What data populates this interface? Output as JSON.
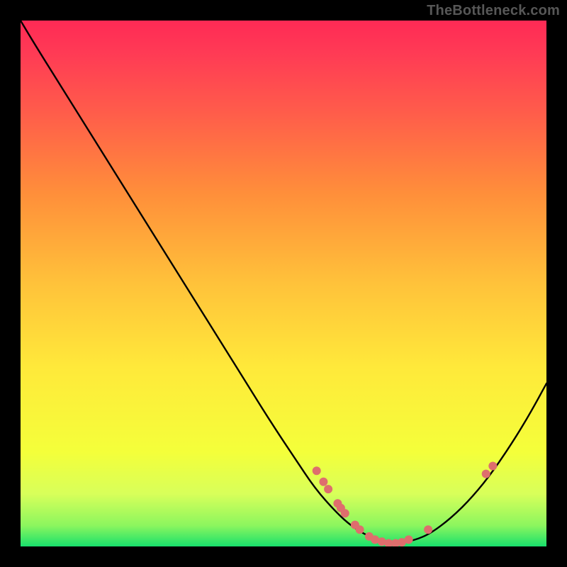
{
  "watermark": "TheBottleneck.com",
  "chart_data": {
    "type": "line",
    "title": "",
    "xlabel": "",
    "ylabel": "",
    "xlim": [
      0,
      100
    ],
    "ylim": [
      0,
      100
    ],
    "background_gradient": {
      "top": "#ff2a55",
      "mid_upper": "#ff8f3a",
      "mid": "#ffe93a",
      "lower": "#d8ff5a",
      "bottom": "#18e06c",
      "direction": "vertical"
    },
    "curve": {
      "name": "bottleneck-curve",
      "x": [
        0.0,
        3.0,
        8.0,
        13.0,
        18.0,
        23.0,
        28.0,
        33.0,
        38.0,
        43.0,
        48.0,
        52.0,
        56.0,
        60.0,
        63.0,
        66.0,
        69.0,
        72.0,
        75.0,
        78.0,
        82.0,
        86.0,
        90.0,
        94.0,
        97.0,
        100.0
      ],
      "y": [
        100.0,
        95.0,
        87.0,
        79.0,
        71.0,
        63.0,
        55.0,
        47.0,
        39.0,
        31.0,
        23.0,
        17.0,
        11.0,
        6.5,
        3.8,
        2.0,
        1.0,
        0.7,
        1.2,
        2.5,
        5.5,
        9.5,
        14.5,
        20.5,
        25.5,
        31.0
      ]
    },
    "markers": {
      "color": "#de6e6d",
      "radius": 6,
      "points": [
        {
          "x": 56.3,
          "y": 14.4
        },
        {
          "x": 57.6,
          "y": 12.3
        },
        {
          "x": 58.5,
          "y": 10.9
        },
        {
          "x": 60.3,
          "y": 8.2
        },
        {
          "x": 60.9,
          "y": 7.3
        },
        {
          "x": 61.7,
          "y": 6.3
        },
        {
          "x": 63.6,
          "y": 4.1
        },
        {
          "x": 64.5,
          "y": 3.2
        },
        {
          "x": 66.3,
          "y": 1.9
        },
        {
          "x": 67.4,
          "y": 1.3
        },
        {
          "x": 68.7,
          "y": 0.9
        },
        {
          "x": 70.0,
          "y": 0.6
        },
        {
          "x": 71.3,
          "y": 0.6
        },
        {
          "x": 72.5,
          "y": 0.8
        },
        {
          "x": 73.8,
          "y": 1.3
        },
        {
          "x": 77.5,
          "y": 3.2
        },
        {
          "x": 88.5,
          "y": 13.8
        },
        {
          "x": 89.8,
          "y": 15.3
        }
      ]
    }
  }
}
